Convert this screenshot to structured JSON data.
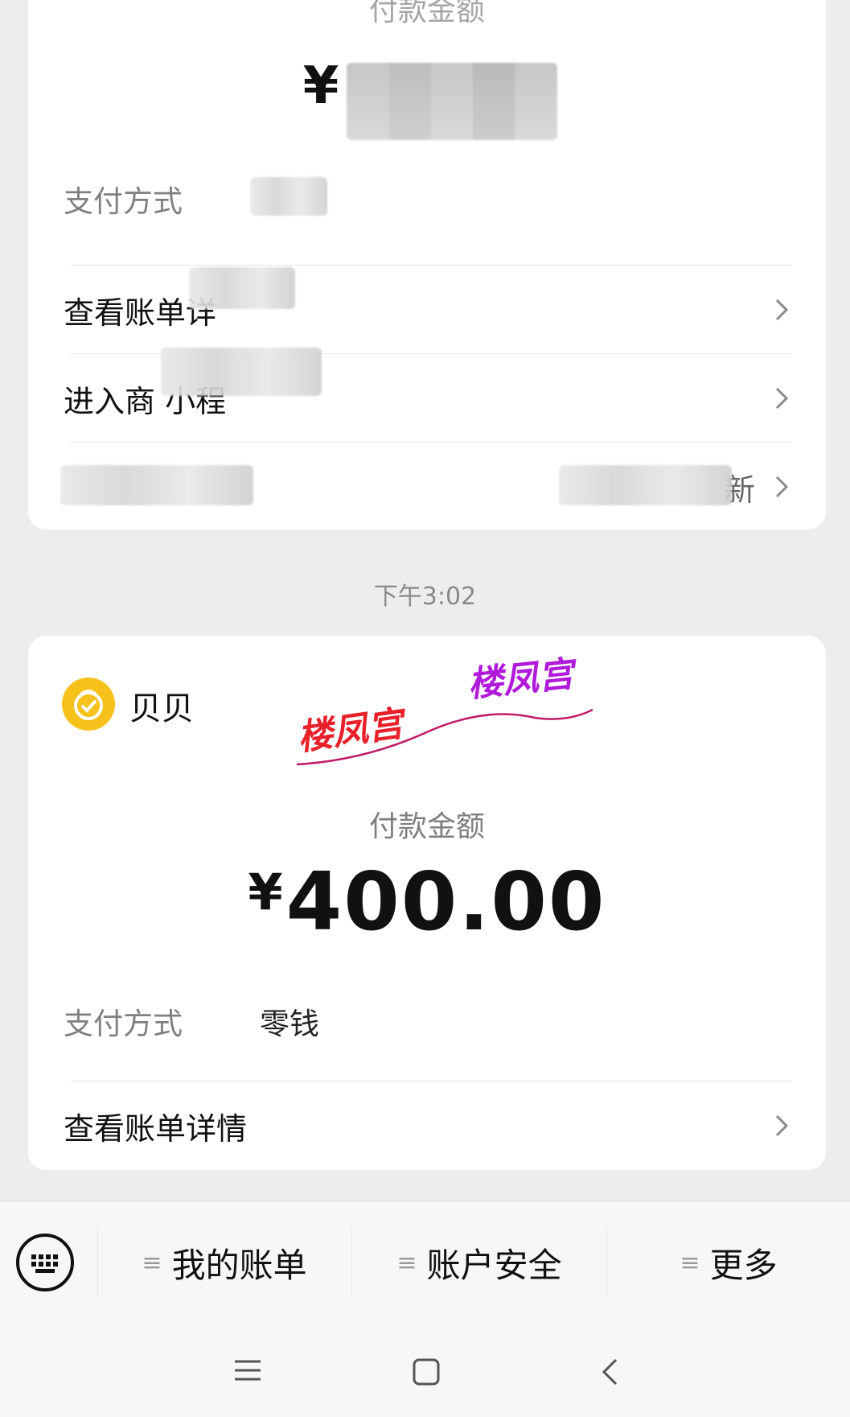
{
  "card1": {
    "amount_label": "付款金额",
    "currency": "¥",
    "pay_method_label": "支付方式",
    "rows": [
      {
        "label": "查看账单详"
      },
      {
        "label": "进入商   小程"
      },
      {
        "label": "",
        "value": "新"
      }
    ]
  },
  "timestamp": "下午3:02",
  "card2": {
    "merchant": "贝贝",
    "watermark": [
      "楼凤宫",
      "楼凤宫"
    ],
    "amount_label": "付款金额",
    "currency": "¥",
    "amount": "400.00",
    "pay_method_label": "支付方式",
    "pay_method_value": "零钱",
    "row_label": "查看账单详情"
  },
  "menu": {
    "items": [
      {
        "label": "我的账单"
      },
      {
        "label": "账户安全"
      },
      {
        "label": "更多"
      }
    ]
  },
  "colors": {
    "merchant_icon": "#f6c11a",
    "watermark_red": "#e8202a",
    "watermark_purple": "#b01adb"
  }
}
